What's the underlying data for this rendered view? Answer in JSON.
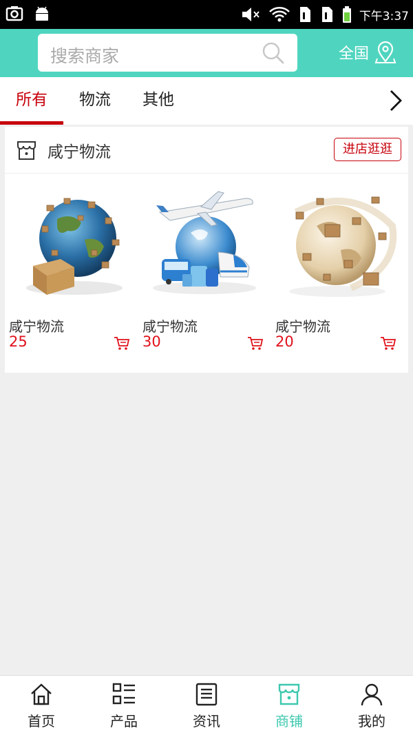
{
  "status_bar": {
    "time": "下午3:37",
    "icons": [
      "screenshot-icon",
      "android-icon",
      "mute-icon",
      "wifi-icon",
      "sim1-icon",
      "sim2-icon",
      "battery-icon"
    ]
  },
  "header": {
    "search_placeholder": "搜索商家",
    "region_label": "全国",
    "accent_color": "#4fd5bf"
  },
  "tabs": {
    "items": [
      {
        "label": "所有",
        "active": true
      },
      {
        "label": "物流",
        "active": false
      },
      {
        "label": "其他",
        "active": false
      }
    ],
    "active_color": "#c7000b"
  },
  "shop": {
    "name": "咸宁物流",
    "visit_label": "进店逛逛",
    "products": [
      {
        "name": "咸宁物流",
        "price": "25",
        "image": "globe-boxes-image"
      },
      {
        "name": "咸宁物流",
        "price": "30",
        "image": "transport-globe-image"
      },
      {
        "name": "咸宁物流",
        "price": "20",
        "image": "parcel-globe-image"
      }
    ]
  },
  "bottom_nav": {
    "items": [
      {
        "label": "首页",
        "icon": "home-icon",
        "active": false
      },
      {
        "label": "产品",
        "icon": "product-list-icon",
        "active": false
      },
      {
        "label": "资讯",
        "icon": "news-icon",
        "active": false
      },
      {
        "label": "商铺",
        "icon": "store-icon",
        "active": true
      },
      {
        "label": "我的",
        "icon": "user-icon",
        "active": false
      }
    ],
    "active_color": "#3cc8ae"
  }
}
